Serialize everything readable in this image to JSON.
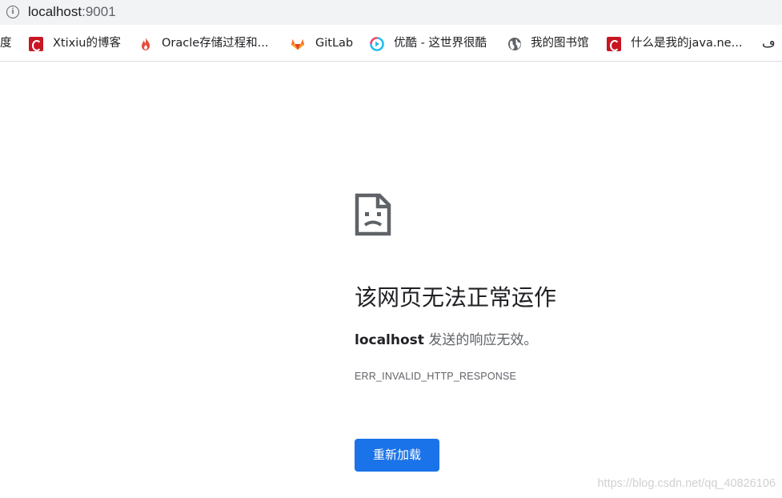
{
  "address_bar": {
    "host": "localhost",
    "port": ":9001"
  },
  "bookmarks": {
    "items": [
      {
        "label": "度",
        "icon": "none"
      },
      {
        "label": "Xtixiu的博客",
        "icon": "csdn-icon"
      },
      {
        "label": "Oracle存储过程和...",
        "icon": "flame-icon"
      },
      {
        "label": "GitLab",
        "icon": "gitlab-icon"
      },
      {
        "label": "优酷 - 这世界很酷",
        "icon": "youku-icon"
      },
      {
        "label": "我的图书馆",
        "icon": "globe-icon"
      },
      {
        "label": "什么是我的java.ne...",
        "icon": "csdn-icon"
      }
    ],
    "overflow_glyph": "ڡ"
  },
  "error_page": {
    "title": "该网页无法正常运作",
    "host": "localhost",
    "description": " 发送的响应无效。",
    "code": "ERR_INVALID_HTTP_RESPONSE",
    "reload_label": "重新加载"
  },
  "watermark": "https://blog.csdn.net/qq_40826106",
  "colors": {
    "omnibox_bg": "#f1f3f4",
    "button_blue": "#1a73e8",
    "csdn_red": "#c81623",
    "gitlab_orange": "#fc6d26",
    "youku_blue": "#1ebbf0"
  }
}
